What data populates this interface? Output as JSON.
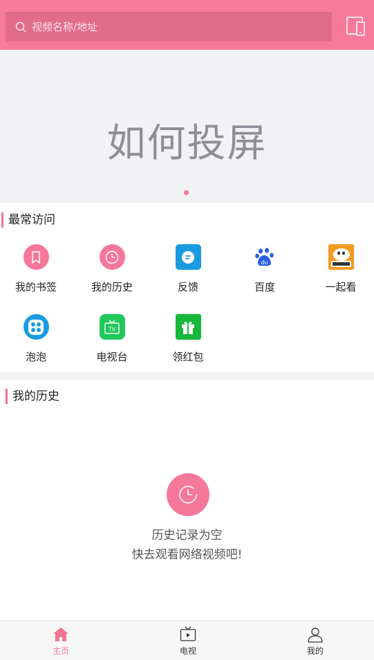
{
  "header": {
    "search_placeholder": "视频名称/地址",
    "colors": {
      "bar": "#f87a9a",
      "search_bg": "#e06b8b"
    }
  },
  "banner": {
    "text": "如何投屏",
    "active_dot": 1,
    "dot_count": 1
  },
  "frequent": {
    "title": "最常访问",
    "items": [
      {
        "label": "我的书签",
        "icon": "bookmark-icon",
        "color": "#f5789a"
      },
      {
        "label": "我的历史",
        "icon": "clock-icon",
        "color": "#f5789a"
      },
      {
        "label": "反馈",
        "icon": "chat-bubble-icon",
        "color": "#1a9be0"
      },
      {
        "label": "百度",
        "icon": "baidu-paw-icon",
        "color": "#2b5fe0"
      },
      {
        "label": "一起看",
        "icon": "douyu-icon",
        "color": "#f39a21"
      },
      {
        "label": "泡泡",
        "icon": "paopao-icon",
        "color": "#1a9be0"
      },
      {
        "label": "电视台",
        "icon": "tv-icon",
        "color": "#1fc85a"
      },
      {
        "label": "领红包",
        "icon": "gift-icon",
        "color": "#17b73c"
      }
    ]
  },
  "history": {
    "title": "我的历史",
    "empty_line1": "历史记录为空",
    "empty_line2": "快去观看网络视频吧!"
  },
  "bottom_nav": {
    "items": [
      {
        "label": "主页",
        "icon": "home-icon",
        "active": true
      },
      {
        "label": "电视",
        "icon": "tv-play-icon",
        "active": false
      },
      {
        "label": "我的",
        "icon": "user-icon",
        "active": false
      }
    ],
    "active_color": "#f37594"
  }
}
